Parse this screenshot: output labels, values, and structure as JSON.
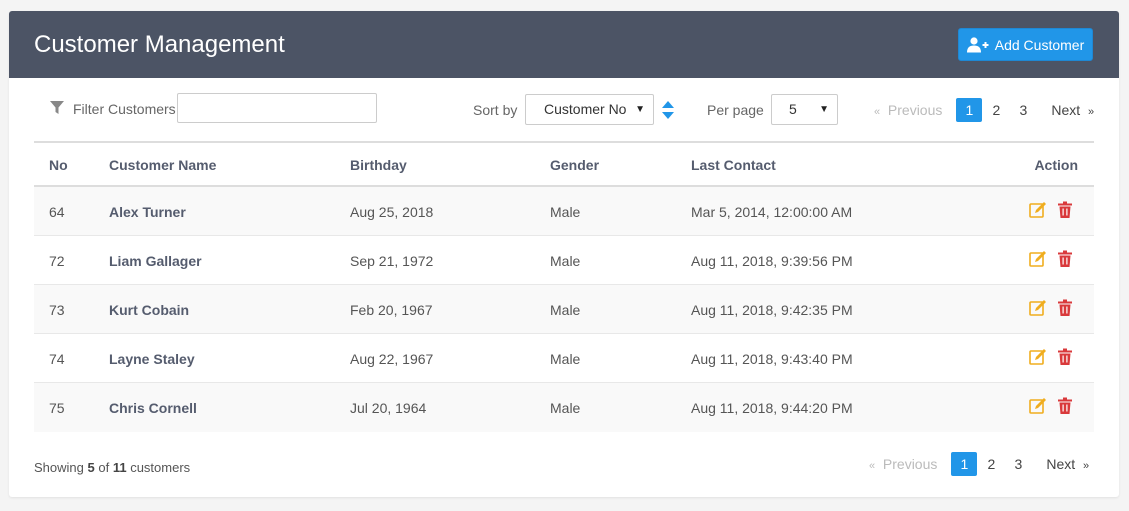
{
  "header": {
    "title": "Customer Management",
    "add_button": "Add Customer"
  },
  "toolbar": {
    "filter_label": "Filter Customers",
    "filter_value": "",
    "sort_label": "Sort by",
    "sort_value": "Customer No",
    "per_page_label": "Per page",
    "per_page_value": "5"
  },
  "pagination": {
    "previous": "Previous",
    "next": "Next",
    "pages": [
      "1",
      "2",
      "3"
    ],
    "active_page": "1"
  },
  "table": {
    "columns": [
      "No",
      "Customer Name",
      "Birthday",
      "Gender",
      "Last Contact",
      "Action"
    ],
    "rows": [
      {
        "no": "64",
        "name": "Alex Turner",
        "birthday": "Aug 25, 2018",
        "gender": "Male",
        "last_contact": "Mar 5, 2014, 12:00:00 AM"
      },
      {
        "no": "72",
        "name": "Liam Gallager",
        "birthday": "Sep 21, 1972",
        "gender": "Male",
        "last_contact": "Aug 11, 2018, 9:39:56 PM"
      },
      {
        "no": "73",
        "name": "Kurt Cobain",
        "birthday": "Feb 20, 1967",
        "gender": "Male",
        "last_contact": "Aug 11, 2018, 9:42:35 PM"
      },
      {
        "no": "74",
        "name": "Layne Staley",
        "birthday": "Aug 22, 1967",
        "gender": "Male",
        "last_contact": "Aug 11, 2018, 9:43:40 PM"
      },
      {
        "no": "75",
        "name": "Chris Cornell",
        "birthday": "Jul 20, 1964",
        "gender": "Male",
        "last_contact": "Aug 11, 2018, 9:44:20 PM"
      }
    ]
  },
  "footer": {
    "showing_prefix": "Showing",
    "shown": "5",
    "of": "of",
    "total": "11",
    "suffix": "customers"
  },
  "icons": {
    "filter": "filter-icon",
    "add_user": "user-plus-icon",
    "sort": "sort-icon",
    "edit": "edit-icon",
    "delete": "trash-icon"
  },
  "colors": {
    "header_bg": "#4c5465",
    "primary": "#2196e8",
    "edit": "#f0ad1e",
    "delete": "#d9393b"
  }
}
